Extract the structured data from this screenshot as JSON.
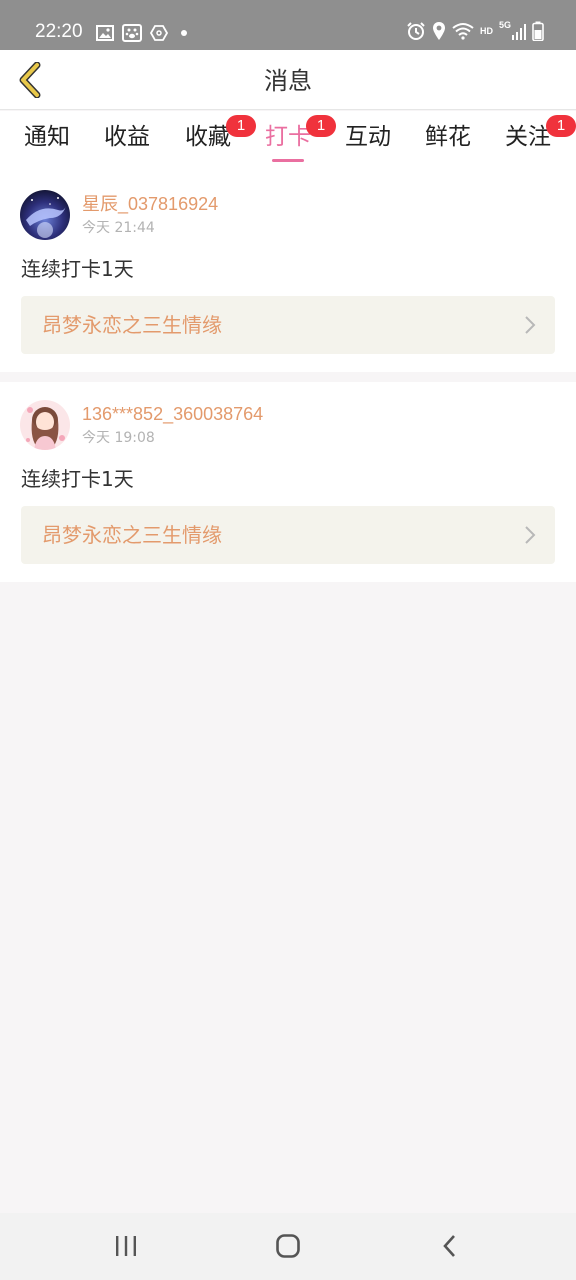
{
  "status_bar": {
    "time": "22:20",
    "left_icons": [
      "image-icon",
      "baidu-paw-icon",
      "hexagon-app-icon",
      "dot-icon"
    ],
    "right_icons": [
      "alarm-icon",
      "location-icon",
      "wifi-icon",
      "hd-indicator",
      "5g-signal-icon",
      "battery-icon"
    ],
    "hd_label": "HD",
    "network_label": "5G"
  },
  "header": {
    "title": "消息",
    "back_icon": "chevron-left-icon",
    "back_color": "#e8c84a"
  },
  "tabs": [
    {
      "label": "通知",
      "badge": ""
    },
    {
      "label": "收益",
      "badge": ""
    },
    {
      "label": "收藏",
      "badge": "1"
    },
    {
      "label": "打卡",
      "badge": "1",
      "active": true
    },
    {
      "label": "互动",
      "badge": ""
    },
    {
      "label": "鲜花",
      "badge": ""
    },
    {
      "label": "关注",
      "badge": "1"
    }
  ],
  "messages": [
    {
      "username": "星辰_037816924",
      "time": "今天 21:44",
      "text": "连续打卡1天",
      "book_title": "昂梦永恋之三生情缘"
    },
    {
      "username": "136***852_360038764",
      "time": "今天 19:08",
      "text": "连续打卡1天",
      "book_title": "昂梦永恋之三生情缘"
    }
  ],
  "colors": {
    "accent": "#ea6fa0",
    "username": "#e39a6c",
    "badge": "#f0323c",
    "book_bg": "#f4f3ec"
  },
  "nav_bar": {
    "icons": [
      "recent-apps-icon",
      "home-icon",
      "back-icon"
    ]
  }
}
